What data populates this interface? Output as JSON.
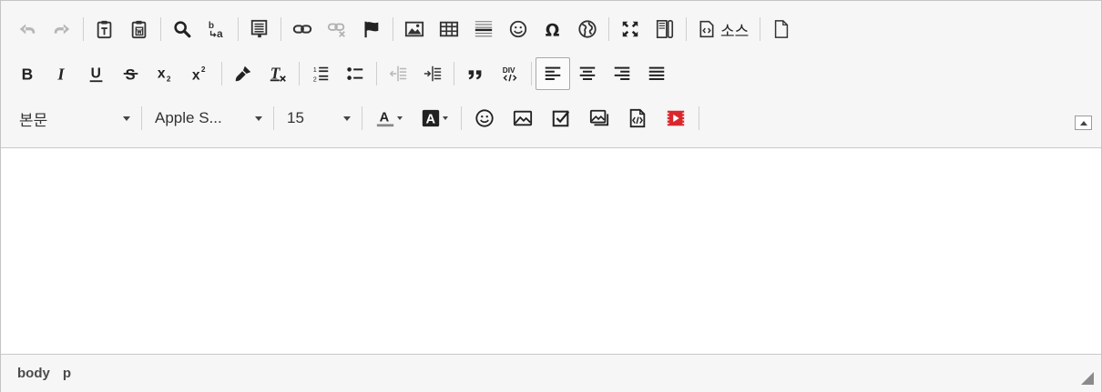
{
  "toolbar": {
    "source_label": "소스",
    "format_select": {
      "value": "본문"
    },
    "font_select": {
      "value": "Apple S..."
    },
    "size_select": {
      "value": "15"
    }
  },
  "statusbar": {
    "path": [
      "body",
      "p"
    ]
  },
  "icons": {
    "undo": "undo-icon",
    "redo": "redo-icon",
    "paste_text": "paste-text-icon",
    "paste_word": "paste-word-icon",
    "find": "search-icon",
    "replace": "replace-icon",
    "template": "template-icon",
    "link": "link-icon",
    "unlink": "unlink-icon",
    "anchor": "flag-icon",
    "image": "image-icon",
    "table": "table-icon",
    "hr": "horizontal-line-icon",
    "smiley": "smiley-icon",
    "special_char": "omega-icon",
    "iframe": "globe-icon",
    "maximize": "maximize-icon",
    "show_blocks": "show-blocks-icon",
    "source": "source-icon",
    "new_page": "new-page-icon",
    "bold": "bold-icon",
    "italic": "italic-icon",
    "underline": "underline-icon",
    "strike": "strikethrough-icon",
    "subscript": "subscript-icon",
    "superscript": "superscript-icon",
    "copy_format": "brush-icon",
    "remove_format": "clear-format-icon",
    "numbered_list": "numbered-list-icon",
    "bulleted_list": "bulleted-list-icon",
    "outdent": "outdent-icon",
    "indent": "indent-icon",
    "blockquote": "quote-icon",
    "div": "div-icon",
    "align_left": "align-left-icon",
    "align_center": "align-center-icon",
    "align_right": "align-right-icon",
    "justify": "justify-icon",
    "text_color": "text-color-icon",
    "bg_color": "background-color-icon",
    "emoji": "emoji-icon",
    "image2": "image-upload-icon",
    "checkbox": "checkbox-icon",
    "gallery": "gallery-icon",
    "code": "code-file-icon",
    "video": "video-icon"
  },
  "colors": {
    "video_red": "#d9282d",
    "text_color_bar": "#888888"
  }
}
